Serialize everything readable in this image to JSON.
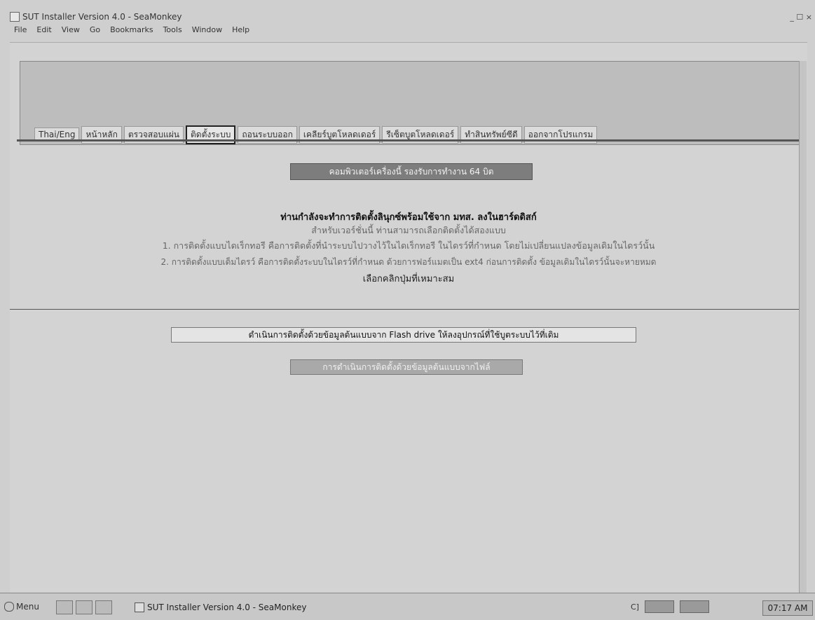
{
  "window": {
    "title": "SUT Installer Version 4.0 - SeaMonkey",
    "controls": "_ ☐ ×"
  },
  "menubar": [
    "File",
    "Edit",
    "View",
    "Go",
    "Bookmarks",
    "Tools",
    "Window",
    "Help"
  ],
  "banner": {
    "title": ""
  },
  "nav": [
    "Thai/Eng",
    "หน้าหลัก",
    "ตรวจสอบแผ่น",
    "ติดตั้งระบบ",
    "ถอนระบบออก",
    "เคลียร์บูตโหลดเดอร์",
    "รีเซ็ตบูตโหลดเดอร์",
    "ทำสินทรัพย์ซีดี",
    "ออกจากโปรแกรม"
  ],
  "notice": "คอมพิวเตอร์เครื่องนี้ รองรับการทำงาน 64 บิต",
  "info": {
    "main": "ท่านกำลังจะทำการติดตั้งลินุกซ์พร้อมใช้จาก มทส. ลงในฮาร์ดดิสก์",
    "sub": "สำหรับเวอร์ชั่นนี้ ท่านสามารถเลือกติดตั้งได้สองแบบ",
    "opt1": "1. การติดตั้งแบบไดเร็กทอรี คือการติดตั้งที่นำระบบไปวางไว้ในไดเร็กทอรี ในไดรว์ที่กำหนด โดยไม่เปลี่ยนแปลงข้อมูลเดิมในไดรว์นั้น",
    "opt2": "2. การติดตั้งแบบเต็มไดรว์ คือการติดตั้งระบบในไดรว์ที่กำหนด ด้วยการฟอร์แมตเป็น ext4 ก่อนการติดตั้ง ข้อมูลเดิมในไดรว์นั้นจะหายหมด",
    "choose": "เลือกคลิกปุ่มที่เหมาะสม"
  },
  "buttons": {
    "flash": "ดำเนินการติดตั้งด้วยข้อมูลต้นแบบจาก Flash drive ให้ลงอุปกรณ์ที่ใช้บูตระบบไว้ที่เดิม",
    "new": "การดำเนินการติดตั้งด้วยข้อมูลต้นแบบจากไฟล์"
  },
  "taskbar": {
    "menu": "Menu",
    "task": "SUT Installer Version 4.0 - SeaMonkey",
    "tray_text": "C]",
    "clock": "07:17 AM"
  }
}
